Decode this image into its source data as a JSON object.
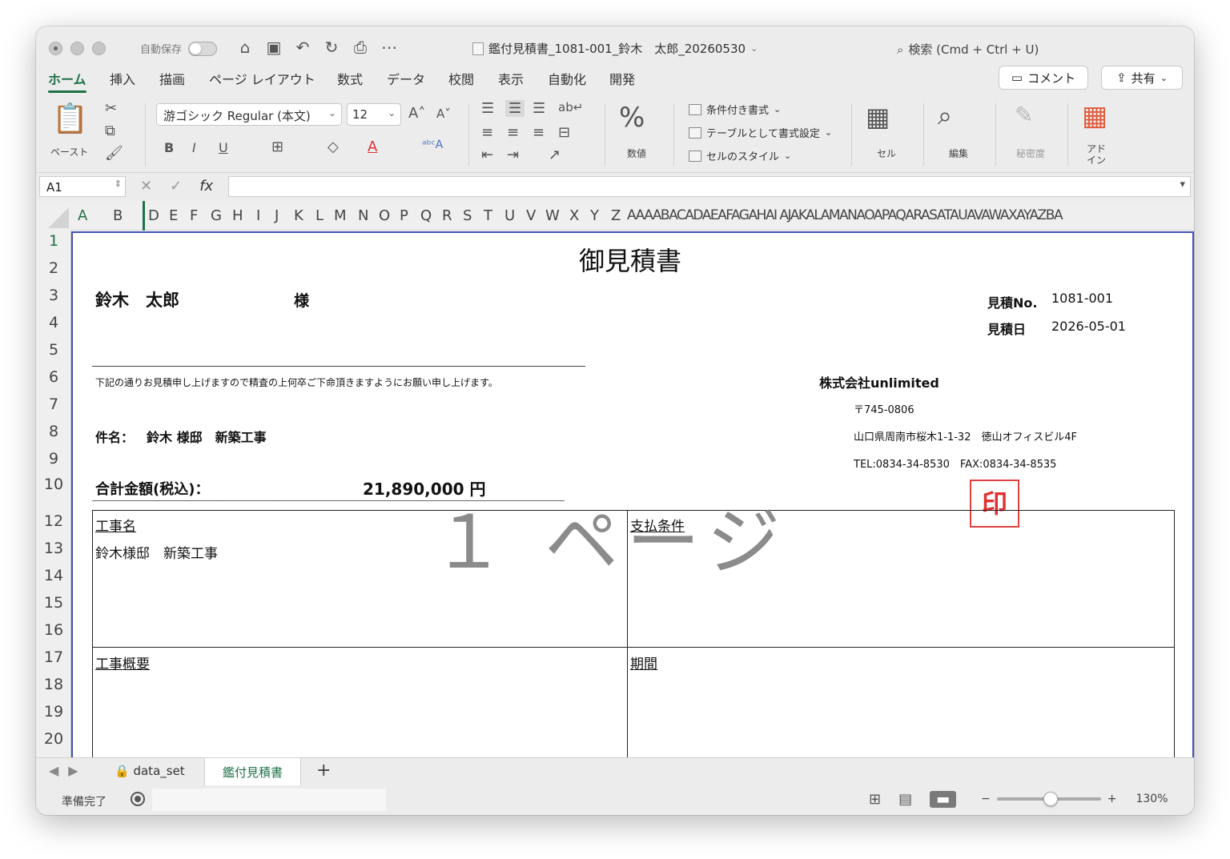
{
  "titlebar": {
    "autosave_label": "自動保存",
    "document_title": "鑑付見積書_1081-001_鈴木　太郎_20260530",
    "search_label": "検索 (Cmd + Ctrl + U)"
  },
  "menu": {
    "tabs": [
      "ホーム",
      "挿入",
      "描画",
      "ページ レイアウト",
      "数式",
      "データ",
      "校閲",
      "表示",
      "自動化",
      "開発"
    ],
    "comment_label": "コメント",
    "share_label": "共有"
  },
  "ribbon": {
    "paste_label": "ペースト",
    "font_name": "游ゴシック Regular (本文)",
    "font_size": "12",
    "number_label": "数値",
    "conditional_format_label": "条件付き書式",
    "table_format_label": "テーブルとして書式設定",
    "cell_style_label": "セルのスタイル",
    "cells_label": "セル",
    "edit_label": "編集",
    "sensitivity_label": "秘密度",
    "addin_label": "アド\nイン"
  },
  "formula_bar": {
    "name_box": "A1",
    "fx": "fx",
    "content": ""
  },
  "columns": [
    "A",
    "B",
    "D",
    "E",
    "F",
    "G",
    "H",
    "I",
    "J",
    "K",
    "L",
    "M",
    "N",
    "O",
    "P",
    "Q",
    "R",
    "S",
    "T",
    "U",
    "V",
    "W",
    "X",
    "Y",
    "Z",
    "AAAABACADAEAFAGAHAI AJAKALAMANAOAPAQARASATAUAVAWAXAYAZBA"
  ],
  "rows": [
    "1",
    "2",
    "3",
    "4",
    "5",
    "6",
    "7",
    "8",
    "9",
    "10",
    "12",
    "13",
    "14",
    "15",
    "16",
    "17",
    "18",
    "19",
    "20"
  ],
  "sheet": {
    "title": "御見積書",
    "customer_name": "鈴木　太郎",
    "honorific": "様",
    "estimate_no_label": "見積No.",
    "estimate_no": "1081-001",
    "estimate_date_label": "見積日",
    "estimate_date": "2026-05-01",
    "greeting": "下記の通りお見積申し上げますので精査の上何卒ご下命頂きますようにお願い申し上げます。",
    "company": "株式会社unlimited",
    "postal": "〒745-0806",
    "address": "山口県周南市桜木1-1-32　徳山オフィスビル4F",
    "contact": "TEL:0834-34-8530　FAX:0834-34-8535",
    "stamp": "印",
    "subject_label": "件名：",
    "subject": "鈴木 様邸　新築工事",
    "total_label": "合計金額(税込)：",
    "total_value": "21,890,000 円",
    "work_name_label": "工事名",
    "work_name": "鈴木様邸　新築工事",
    "payment_label": "支払条件",
    "overview_label": "工事概要",
    "period_label": "期間",
    "watermark": "１ ページ"
  },
  "sheet_tabs": {
    "tab1": "data_set",
    "tab2": "鑑付見積書",
    "add": "+"
  },
  "status": {
    "ready": "準備完了",
    "zoom": "130%"
  }
}
